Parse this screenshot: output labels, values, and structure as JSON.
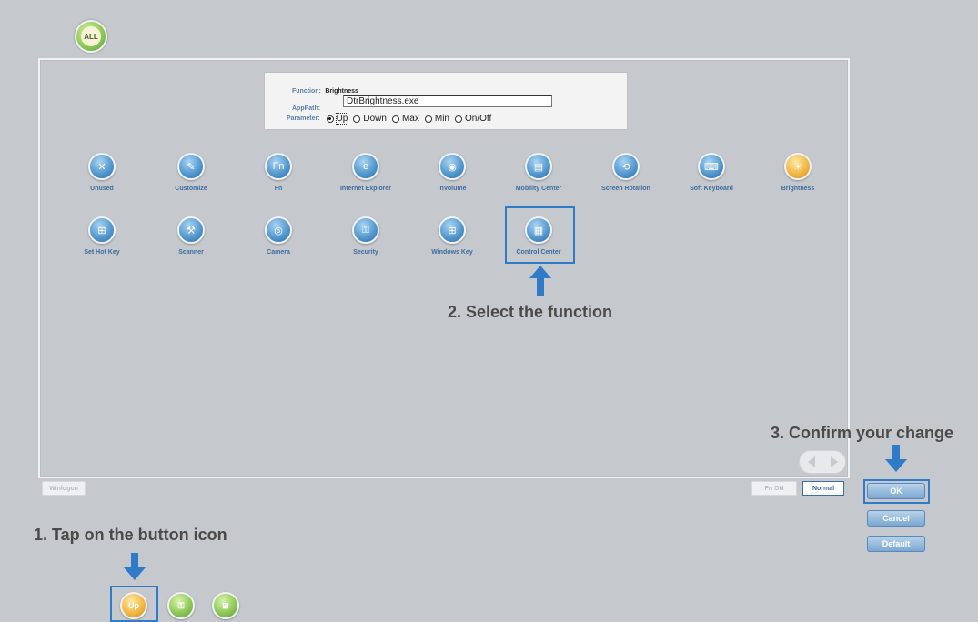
{
  "top": {
    "all_label": "ALL"
  },
  "info": {
    "function_label": "Function:",
    "function_value": "Brightness",
    "apppath_label": "AppPath:",
    "apppath_value": "DtrBrightness.exe",
    "parameter_label": "Parameter:",
    "options": [
      "Up",
      "Down",
      "Max",
      "Min",
      "On/Off"
    ],
    "selected_option": "Up"
  },
  "functions_row1": [
    "Unused",
    "Customize",
    "Fn",
    "Internet Explorer",
    "InVolume",
    "Mobility Center",
    "Screen Rotation",
    "Soft Keyboard",
    "Brightness"
  ],
  "functions_row2": [
    "Set Hot Key",
    "Scanner",
    "Camera",
    "Security",
    "Windows Key",
    "Control Center"
  ],
  "icons": {
    "fn_text": "Fn",
    "up_text": "Up"
  },
  "annotations": {
    "step1": "1. Tap on the button icon",
    "step2": "2. Select the function",
    "step3": "3. Confirm your change"
  },
  "buttons": {
    "winlogon": "Winlogon",
    "fn_on": "Fn ON",
    "normal": "Normal",
    "ok": "OK",
    "cancel": "Cancel",
    "default": "Default"
  },
  "colors": {
    "accent": "#2f7bc8",
    "label_blue": "#3d6ea0",
    "background": "#c5c8cc"
  }
}
